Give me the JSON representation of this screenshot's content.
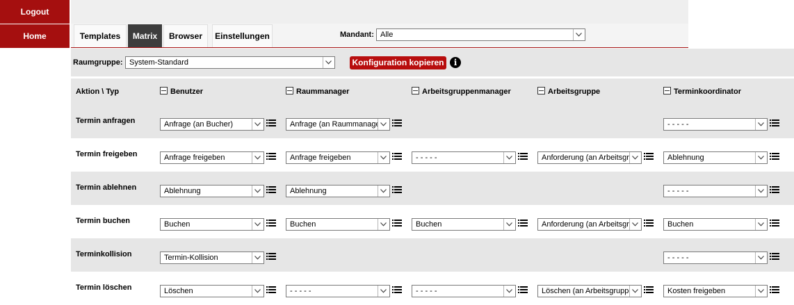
{
  "sidebar": {
    "logout_label": "Logout",
    "home_label": "Home"
  },
  "tabs": [
    {
      "label": "Templates",
      "active": false
    },
    {
      "label": "Matrix",
      "active": true
    },
    {
      "label": "Browser",
      "active": false
    },
    {
      "label": "Einstellungen",
      "active": false
    }
  ],
  "mandant": {
    "label": "Mandant:",
    "value": "Alle"
  },
  "raumgruppe": {
    "label": "Raumgruppe:",
    "value": "System-Standard"
  },
  "kopieren_label": "Konfiguration kopieren",
  "info_icon": "i",
  "matrix": {
    "corner_label": "Aktion \\ Typ",
    "columns": [
      "Benutzer",
      "Raummanager",
      "Arbeitsgruppenmanager",
      "Arbeitsgruppe",
      "Terminkoordinator"
    ],
    "rows": [
      {
        "label": "Termin anfragen",
        "cells": [
          "Anfrage (an Bucher)",
          "Anfrage (an Raummanager)",
          null,
          null,
          "- - - - -"
        ]
      },
      {
        "label": "Termin freigeben",
        "cells": [
          "Anfrage freigeben",
          "Anfrage freigeben",
          "- - - - -",
          "Anforderung (an Arbeitsgruppe)",
          "Ablehnung"
        ]
      },
      {
        "label": "Termin ablehnen",
        "cells": [
          "Ablehnung",
          "Ablehnung",
          null,
          null,
          "- - - - -"
        ]
      },
      {
        "label": "Termin buchen",
        "cells": [
          "Buchen",
          "Buchen",
          "Buchen",
          "Anforderung (an Arbeitsgruppe)",
          "Buchen"
        ]
      },
      {
        "label": "Terminkollision",
        "cells": [
          "Termin-Kollision",
          null,
          null,
          null,
          "- - - - -"
        ]
      },
      {
        "label": "Termin löschen",
        "cells": [
          "Löschen",
          "- - - - -",
          "- - - - -",
          "Löschen (an Arbeitsgruppe)",
          "Kosten freigeben"
        ]
      }
    ]
  },
  "colors": {
    "brand_red": "#a50f0f",
    "button_red": "#b80d0d",
    "active_tab": "#3d3d3d",
    "row_shade": "#e6e6e6"
  },
  "icons": {
    "dropdown": "chevron-down-icon",
    "list": "list-icon",
    "collapse": "minus-square-icon",
    "info": "info-icon"
  }
}
